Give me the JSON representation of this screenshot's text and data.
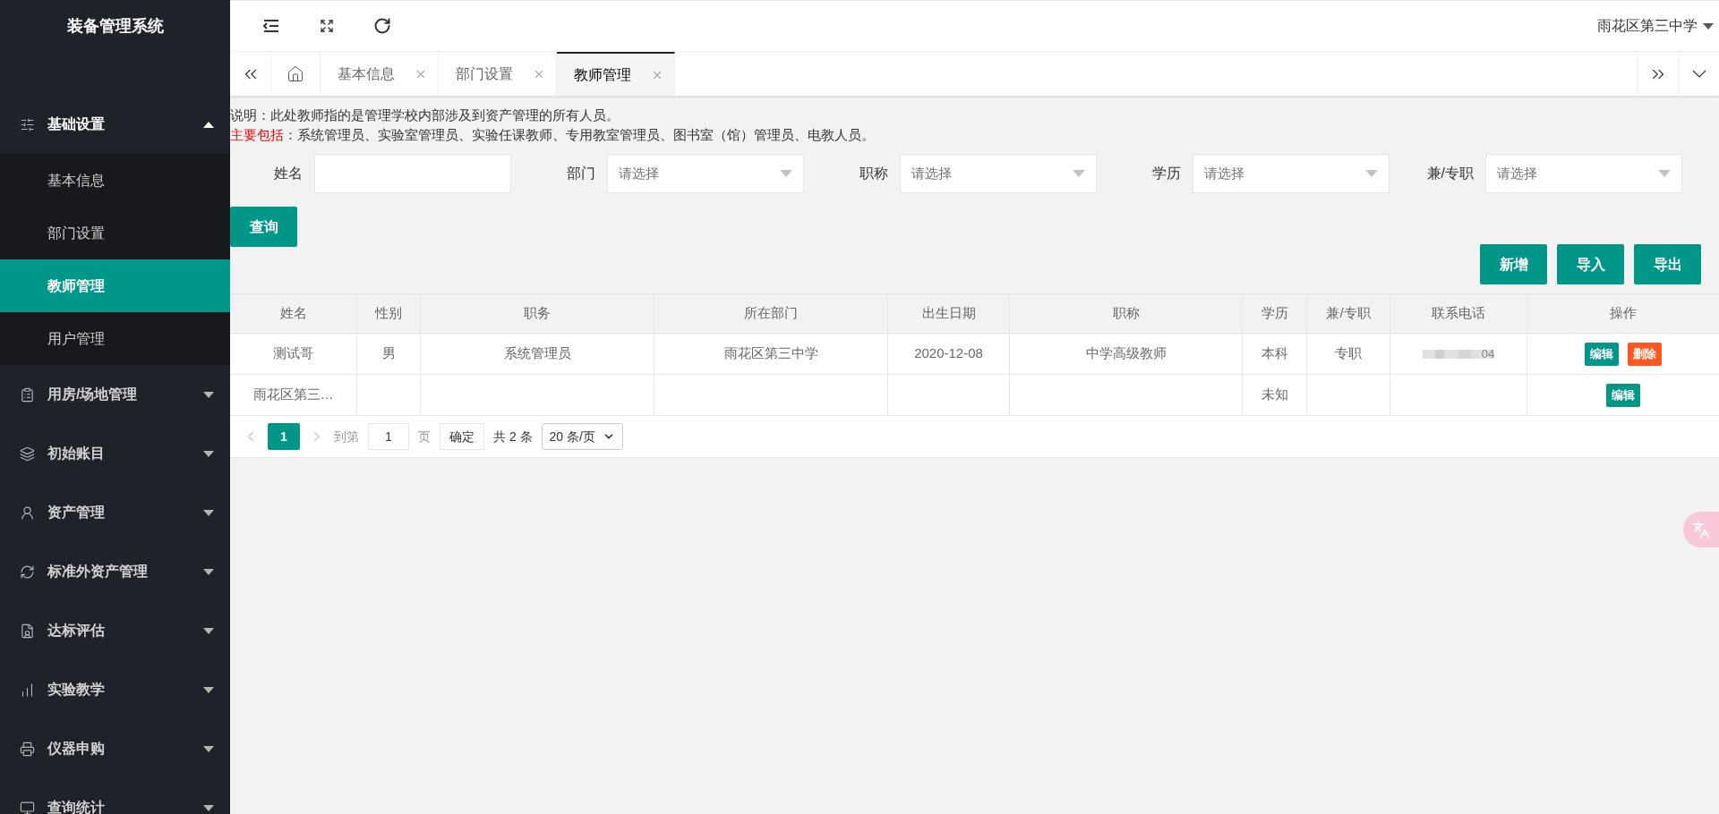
{
  "sidebar": {
    "title": "装备管理系统",
    "items": [
      {
        "label": "基础设置",
        "expanded": true,
        "children": [
          {
            "label": "基本信息",
            "selected": false
          },
          {
            "label": "部门设置",
            "selected": false
          },
          {
            "label": "教师管理",
            "selected": true
          },
          {
            "label": "用户管理",
            "selected": false
          }
        ]
      },
      {
        "label": "用房/场地管理",
        "expanded": false
      },
      {
        "label": "初始账目",
        "expanded": false
      },
      {
        "label": "资产管理",
        "expanded": false
      },
      {
        "label": "标准外资产管理",
        "expanded": false
      },
      {
        "label": "达标评估",
        "expanded": false
      },
      {
        "label": "实验教学",
        "expanded": false
      },
      {
        "label": "仪器申购",
        "expanded": false
      },
      {
        "label": "查询统计",
        "expanded": false
      }
    ]
  },
  "header": {
    "user": "雨花区第三中学"
  },
  "tabs": [
    {
      "label": "基本信息",
      "selected": false
    },
    {
      "label": "部门设置",
      "selected": false
    },
    {
      "label": "教师管理",
      "selected": true
    }
  ],
  "notice": {
    "line1": "说明：此处教师指的是管理学校内部涉及到资产管理的所有人员。",
    "line2_highlight": "主要包括",
    "line2": "：系统管理员、实验室管理员、实验任课教师、专用教室管理员、图书室（馆）管理员、电教人员。"
  },
  "filters": [
    {
      "label": "姓名",
      "kind": "text"
    },
    {
      "label": "部门",
      "kind": "select",
      "placeholder": "请选择"
    },
    {
      "label": "职称",
      "kind": "select",
      "placeholder": "请选择"
    },
    {
      "label": "学历",
      "kind": "select",
      "placeholder": "请选择"
    },
    {
      "label": "兼/专职",
      "kind": "select",
      "placeholder": "请选择"
    }
  ],
  "search_button": "查询",
  "toolbar": [
    "新增",
    "导入",
    "导出"
  ],
  "table": {
    "columns": [
      "姓名",
      "性别",
      "职务",
      "所在部门",
      "出生日期",
      "职称",
      "学历",
      "兼/专职",
      "联系电话",
      "操作"
    ],
    "rows": [
      {
        "cells": [
          "测试哥",
          "男",
          "系统管理员",
          "雨花区第三中学",
          "2020-12-08",
          "中学高级教师",
          "本科",
          "专职",
          "04",
          ""
        ],
        "phone_blurred": true,
        "actions": [
          {
            "label": "编辑",
            "kind": "edit"
          },
          {
            "label": "删除",
            "kind": "delete"
          }
        ]
      },
      {
        "cells": [
          "雨花区第三…",
          "",
          "",
          "",
          "",
          "",
          "未知",
          "",
          "",
          ""
        ],
        "phone_blurred": false,
        "actions": [
          {
            "label": "编辑",
            "kind": "edit"
          }
        ]
      }
    ]
  },
  "pagination": {
    "pages": [
      {
        "label": "1",
        "selected": true
      }
    ],
    "goto_label": "到第",
    "goto_value": "1",
    "page_unit": "页",
    "confirm": "确定",
    "total": "共 2 条",
    "page_size": "20 条/页"
  }
}
